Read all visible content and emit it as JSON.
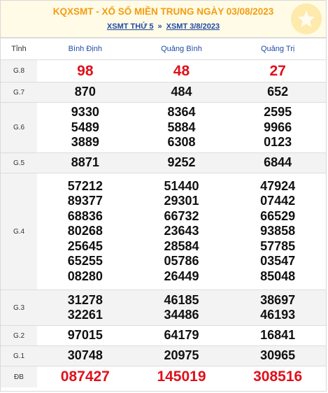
{
  "header": {
    "title": "KQXSMT - XỔ SỐ MIỀN TRUNG NGÀY 03/08/2023",
    "link1": "XSMT THỨ 5",
    "separator": "»",
    "link2": "XSMT 3/8/2023"
  },
  "columns": {
    "label": "Tỉnh",
    "provinces": [
      "Bình Định",
      "Quảng Bình",
      "Quảng Trị"
    ]
  },
  "prizes": [
    {
      "label": "G.8",
      "red": true,
      "values": [
        [
          "98"
        ],
        [
          "48"
        ],
        [
          "27"
        ]
      ]
    },
    {
      "label": "G.7",
      "red": false,
      "values": [
        [
          "870"
        ],
        [
          "484"
        ],
        [
          "652"
        ]
      ]
    },
    {
      "label": "G.6",
      "red": false,
      "values": [
        [
          "9330",
          "5489",
          "3889"
        ],
        [
          "8364",
          "5884",
          "6308"
        ],
        [
          "2595",
          "9966",
          "0123"
        ]
      ]
    },
    {
      "label": "G.5",
      "red": false,
      "values": [
        [
          "8871"
        ],
        [
          "9252"
        ],
        [
          "6844"
        ]
      ]
    },
    {
      "label": "G.4",
      "red": false,
      "values": [
        [
          "57212",
          "89377",
          "68836",
          "80268",
          "25645",
          "65255",
          "08280"
        ],
        [
          "51440",
          "29301",
          "66732",
          "23643",
          "28584",
          "05786",
          "26449"
        ],
        [
          "47924",
          "07442",
          "66529",
          "93858",
          "57785",
          "03547",
          "85048"
        ]
      ]
    },
    {
      "label": "G.3",
      "red": false,
      "values": [
        [
          "31278",
          "32261"
        ],
        [
          "46185",
          "34486"
        ],
        [
          "38697",
          "46193"
        ]
      ]
    },
    {
      "label": "G.2",
      "red": false,
      "values": [
        [
          "97015"
        ],
        [
          "64179"
        ],
        [
          "16841"
        ]
      ]
    },
    {
      "label": "G.1",
      "red": false,
      "values": [
        [
          "30748"
        ],
        [
          "20975"
        ],
        [
          "30965"
        ]
      ]
    },
    {
      "label": "ĐB",
      "red": true,
      "values": [
        [
          "087427"
        ],
        [
          "145019"
        ],
        [
          "308516"
        ]
      ]
    }
  ],
  "colors": {
    "title": "#f39c12",
    "link": "#1f4aa6",
    "highlight": "#e0101b",
    "stripe": "#f3f3f3"
  },
  "icons": {
    "logo": "star-logo-icon"
  }
}
